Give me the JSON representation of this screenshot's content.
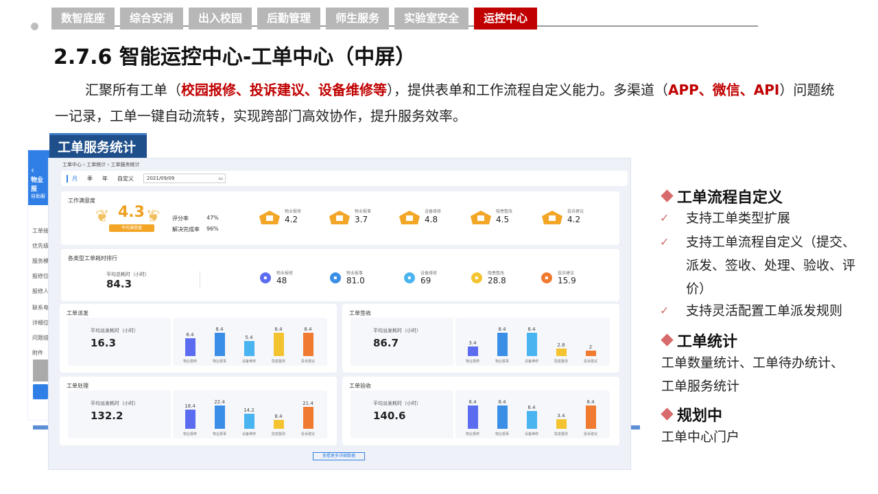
{
  "nav": {
    "tabs": [
      {
        "label": "数智底座",
        "active": false
      },
      {
        "label": "综合安消",
        "active": false
      },
      {
        "label": "出入校园",
        "active": false
      },
      {
        "label": "后勤管理",
        "active": false
      },
      {
        "label": "师生服务",
        "active": false
      },
      {
        "label": "实验室安全",
        "active": false
      },
      {
        "label": "运控中心",
        "active": true
      }
    ],
    "active_color": "#c00000"
  },
  "title": "2.7.6 智能运控中心-工单中心（中屏）",
  "intro": {
    "p1": "汇聚所有工单（",
    "h1": "校园报修、投诉建议、设备维修等",
    "p2": "），提供表单和工作流程自定义能力。多渠道（",
    "h2": "APP、微信、API",
    "p3": "）问题统一记录，工单一键自动流转，实现跨部门高效协作，提升服务效率。"
  },
  "panel": {
    "tag": "工单服务统计",
    "breadcrumb": "工单中心  ›  工单统计  ›  工单服务统计",
    "filter": {
      "seg1": "月",
      "seg2": "季",
      "seg3": "年",
      "seg4": "自定义",
      "date": "2021/09/09"
    },
    "satisfaction": {
      "title": "工作满意度",
      "score": "4.3",
      "badge": "平均满意度",
      "rate_label": "评分率",
      "rate_value": "47%",
      "resolve_label": "解决完成率",
      "resolve_value": "96%",
      "metrics": [
        {
          "label": "物业报修",
          "value": "4.2"
        },
        {
          "label": "物业报事",
          "value": "3.7"
        },
        {
          "label": "设备维修",
          "value": "4.8"
        },
        {
          "label": "隐患整改",
          "value": "4.5"
        },
        {
          "label": "投诉建议",
          "value": "4.2"
        }
      ]
    },
    "time_rank": {
      "title": "各类型工单耗时排行",
      "avg_label": "平均总耗时（小时）",
      "avg_value": "84.3",
      "items": [
        {
          "label": "物业报修",
          "value": "48",
          "color": "#5b6cf0"
        },
        {
          "label": "物业报事",
          "value": "81.0",
          "color": "#3a8ee6"
        },
        {
          "label": "设备维修",
          "value": "69",
          "color": "#49b4f0"
        },
        {
          "label": "隐患整改",
          "value": "28.8",
          "color": "#f4c430"
        },
        {
          "label": "投诉建议",
          "value": "15.9",
          "color": "#f07a30"
        }
      ]
    },
    "mini_cards": [
      {
        "title": "工单派发",
        "avg_label": "平均派发耗时（小时）",
        "avg_value": "16.3",
        "bars": [
          6.4,
          8.4,
          5.4,
          8.4,
          8.4
        ],
        "cats": [
          "物业报修",
          "物业报事",
          "设备维修",
          "隐患整改",
          "投诉建议"
        ]
      },
      {
        "title": "工单签收",
        "avg_label": "平均派发耗时（小时）",
        "avg_value": "86.7",
        "bars": [
          3.4,
          8.4,
          8.4,
          2.8,
          2
        ],
        "cats": [
          "物业报修",
          "物业报事",
          "设备维修",
          "隐患整改",
          "投诉建议"
        ]
      },
      {
        "title": "工单处理",
        "avg_label": "平均派发耗时（小时）",
        "avg_value": "132.2",
        "bars": [
          18.4,
          22.4,
          14.2,
          8.4,
          21.4
        ],
        "cats": [
          "物业报修",
          "物业报事",
          "设备维修",
          "隐患整改",
          "投诉建议"
        ]
      },
      {
        "title": "工单验收",
        "avg_label": "平均派发耗时（小时）",
        "avg_value": "140.6",
        "bars": [
          8.4,
          8.4,
          6.4,
          3.4,
          8.4
        ],
        "cats": [
          "物业报修",
          "物业报事",
          "设备维修",
          "隐患整改",
          "投诉建议"
        ]
      }
    ],
    "bar_colors": [
      "#5b6cf0",
      "#3a8ee6",
      "#49b4f0",
      "#f4c430",
      "#f07a30"
    ],
    "more_button": "查看更多详细数据"
  },
  "back_app": {
    "header": "物业报",
    "sub": "自助服",
    "rows": [
      "工单接",
      "优先级",
      "服务模",
      "报修位",
      "报修人",
      "联系电",
      "详细位",
      "问题描",
      "附件"
    ]
  },
  "right": {
    "h1": "工单流程自定义",
    "items": [
      "支持工单类型扩展",
      "支持工单流程自定义（提交、派发、签收、处理、验收、评价）",
      "支持灵活配置工单派发规则"
    ],
    "h2": "工单统计",
    "stats_line1": "工单数量统计、工单待办统计、",
    "stats_line2": "工单服务统计",
    "h3": "规划中",
    "plan": "工单中心门户"
  }
}
